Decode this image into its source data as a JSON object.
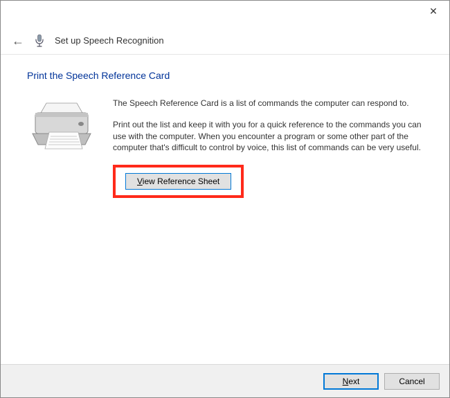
{
  "titlebar": {
    "close_glyph": "✕"
  },
  "header": {
    "back_glyph": "←",
    "title": "Set up Speech Recognition"
  },
  "page": {
    "title": "Print the Speech Reference Card",
    "para1": "The Speech Reference Card is a list of commands the computer can respond to.",
    "para2": "Print out the list and keep it with you for a quick reference to the commands you can use with the computer. When you encounter a program or some other part of the computer that's difficult to control by voice, this list of commands can be very useful.",
    "view_ref_prefix": "V",
    "view_ref_rest": "iew Reference Sheet"
  },
  "footer": {
    "next_prefix": "N",
    "next_rest": "ext",
    "cancel": "Cancel"
  }
}
